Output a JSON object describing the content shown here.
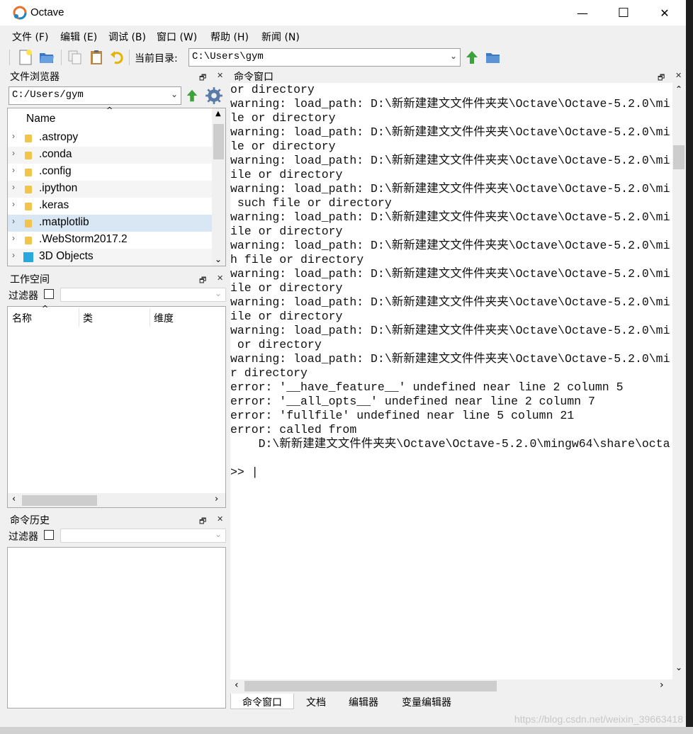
{
  "window": {
    "title": "Octave",
    "controls": {
      "minimize": "—",
      "maximize": "☐",
      "close": "✕"
    }
  },
  "menu": [
    {
      "label": "文件 (F)"
    },
    {
      "label": "编辑 (E)"
    },
    {
      "label": "调试 (B)"
    },
    {
      "label": "窗口 (W)"
    },
    {
      "label": "帮助 (H)"
    },
    {
      "label": "新闻 (N)"
    }
  ],
  "toolbar": {
    "icons": [
      "new-script-icon",
      "open-folder-icon",
      "copy-icon",
      "paste-icon",
      "undo-icon"
    ],
    "current_dir_label": "当前目录:",
    "current_dir_value": "C:\\Users\\gym",
    "nav_icons": [
      "parent-dir-up-arrow-icon",
      "browse-folder-icon"
    ]
  },
  "file_browser": {
    "title": "文件浏览器",
    "path": "C:/Users/gym",
    "column_name": "Name",
    "items": [
      {
        "label": ".astropy",
        "type": "folder"
      },
      {
        "label": ".conda",
        "type": "folder"
      },
      {
        "label": ".config",
        "type": "folder"
      },
      {
        "label": ".ipython",
        "type": "folder"
      },
      {
        "label": ".keras",
        "type": "folder"
      },
      {
        "label": ".matplotlib",
        "type": "folder",
        "selected": true
      },
      {
        "label": ".WebStorm2017.2",
        "type": "folder"
      },
      {
        "label": "3D Objects",
        "type": "3d-objects"
      }
    ]
  },
  "workspace": {
    "title": "工作空间",
    "filter_label": "过滤器",
    "columns": [
      "名称",
      "类",
      "维度"
    ]
  },
  "history": {
    "title": "命令历史",
    "filter_label": "过滤器"
  },
  "console": {
    "title": "命令窗口",
    "lines": [
      "or directory",
      "warning: load_path: D:\\新新建建文文件件夹夹\\Octave\\Octave-5.2.0\\mi",
      "le or directory",
      "warning: load_path: D:\\新新建建文文件件夹夹\\Octave\\Octave-5.2.0\\mi",
      "le or directory",
      "warning: load_path: D:\\新新建建文文件件夹夹\\Octave\\Octave-5.2.0\\mi",
      "ile or directory",
      "warning: load_path: D:\\新新建建文文件件夹夹\\Octave\\Octave-5.2.0\\mi",
      " such file or directory",
      "warning: load_path: D:\\新新建建文文件件夹夹\\Octave\\Octave-5.2.0\\mi",
      "ile or directory",
      "warning: load_path: D:\\新新建建文文件件夹夹\\Octave\\Octave-5.2.0\\mi",
      "h file or directory",
      "warning: load_path: D:\\新新建建文文件件夹夹\\Octave\\Octave-5.2.0\\mi",
      "ile or directory",
      "warning: load_path: D:\\新新建建文文件件夹夹\\Octave\\Octave-5.2.0\\mi",
      "ile or directory",
      "warning: load_path: D:\\新新建建文文件件夹夹\\Octave\\Octave-5.2.0\\mi",
      " or directory",
      "warning: load_path: D:\\新新建建文文件件夹夹\\Octave\\Octave-5.2.0\\mi",
      "r directory",
      "error: '__have_feature__' undefined near line 2 column 5",
      "error: '__all_opts__' undefined near line 2 column 7",
      "error: 'fullfile' undefined near line 5 column 21",
      "error: called from",
      "    D:\\新新建建文文件件夹夹\\Octave\\Octave-5.2.0\\mingw64\\share\\octa",
      "",
      ">> |"
    ]
  },
  "bottom_tabs": [
    {
      "label": "命令窗口",
      "active": true
    },
    {
      "label": "文档"
    },
    {
      "label": "编辑器"
    },
    {
      "label": "变量编辑器"
    }
  ],
  "watermark": "https://blog.csdn.net/weixin_39663418"
}
